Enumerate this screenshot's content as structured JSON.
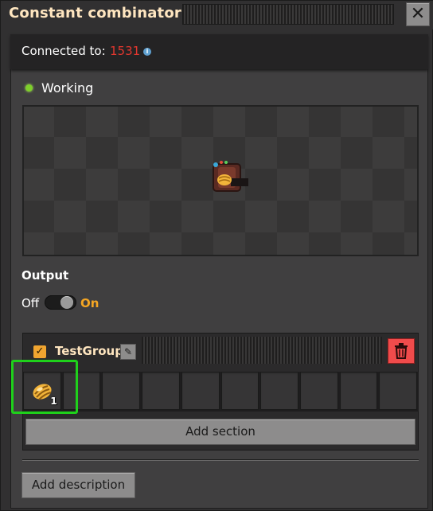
{
  "window": {
    "title": "Constant combinator",
    "close_icon": "close-icon"
  },
  "connection": {
    "label": "Connected to:",
    "value": "1531",
    "info_icon": "info-icon"
  },
  "status": {
    "text": "Working",
    "color": "#7ecf2b"
  },
  "output": {
    "label": "Output",
    "off_label": "Off",
    "on_label": "On",
    "state": "on"
  },
  "section": {
    "enabled": true,
    "group_name": "TestGroup",
    "edit_icon": "pencil-icon",
    "delete_icon": "trash-icon",
    "slots": [
      {
        "item": "larva-item-icon",
        "count": "1"
      },
      {
        "item": "",
        "count": ""
      },
      {
        "item": "",
        "count": ""
      },
      {
        "item": "",
        "count": ""
      },
      {
        "item": "",
        "count": ""
      },
      {
        "item": "",
        "count": ""
      },
      {
        "item": "",
        "count": ""
      },
      {
        "item": "",
        "count": ""
      },
      {
        "item": "",
        "count": ""
      },
      {
        "item": "",
        "count": ""
      }
    ]
  },
  "buttons": {
    "add_section": "Add section",
    "add_description": "Add description"
  },
  "colors": {
    "accent_on": "#f5a623",
    "connected_value": "#e2372f",
    "delete": "#f04b4b",
    "highlight": "#1fd11b"
  }
}
